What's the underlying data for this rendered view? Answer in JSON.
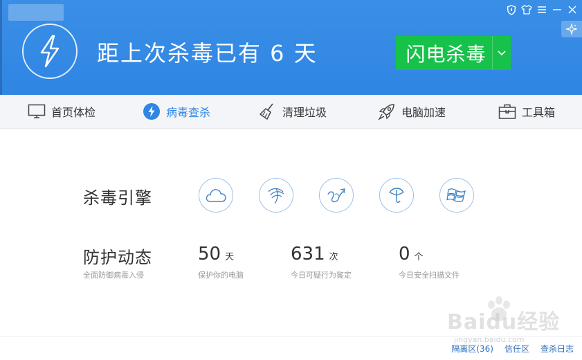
{
  "header": {
    "title": "距上次杀毒已有 6 天",
    "scan_button_label": "闪电杀毒",
    "accent_color": "#2f86e3",
    "scan_button_color": "#17c24a"
  },
  "window_controls": [
    "shield-icon",
    "shirt-icon",
    "menu-icon",
    "minimize-icon",
    "close-icon"
  ],
  "nav": {
    "items": [
      {
        "label": "首页体检",
        "icon": "monitor-icon"
      },
      {
        "label": "病毒查杀",
        "icon": "bolt-icon"
      },
      {
        "label": "清理垃圾",
        "icon": "broom-icon"
      },
      {
        "label": "电脑加速",
        "icon": "rocket-icon"
      },
      {
        "label": "工具箱",
        "icon": "toolbox-icon"
      }
    ],
    "active_index": 1
  },
  "engines": {
    "label": "杀毒引擎",
    "items": [
      "cloud-icon",
      "qvm-engine-icon",
      "heuristic-engine-icon",
      "umbrella-icon",
      "windows-icon"
    ]
  },
  "protection": {
    "title": "防护动态",
    "subtitle": "全面防御病毒入侵",
    "stats": [
      {
        "value": "50",
        "unit": "天",
        "desc": "保护你的电脑"
      },
      {
        "value": "631",
        "unit": "次",
        "desc": "今日可疑行为鉴定"
      },
      {
        "value": "0",
        "unit": "个",
        "desc": "今日安全扫描文件"
      }
    ]
  },
  "footer": {
    "links": [
      "隔离区(36)",
      "信任区",
      "查杀日志"
    ]
  },
  "watermark": {
    "text": "Baidu经验",
    "sub": "jingyan.baidu.com"
  }
}
